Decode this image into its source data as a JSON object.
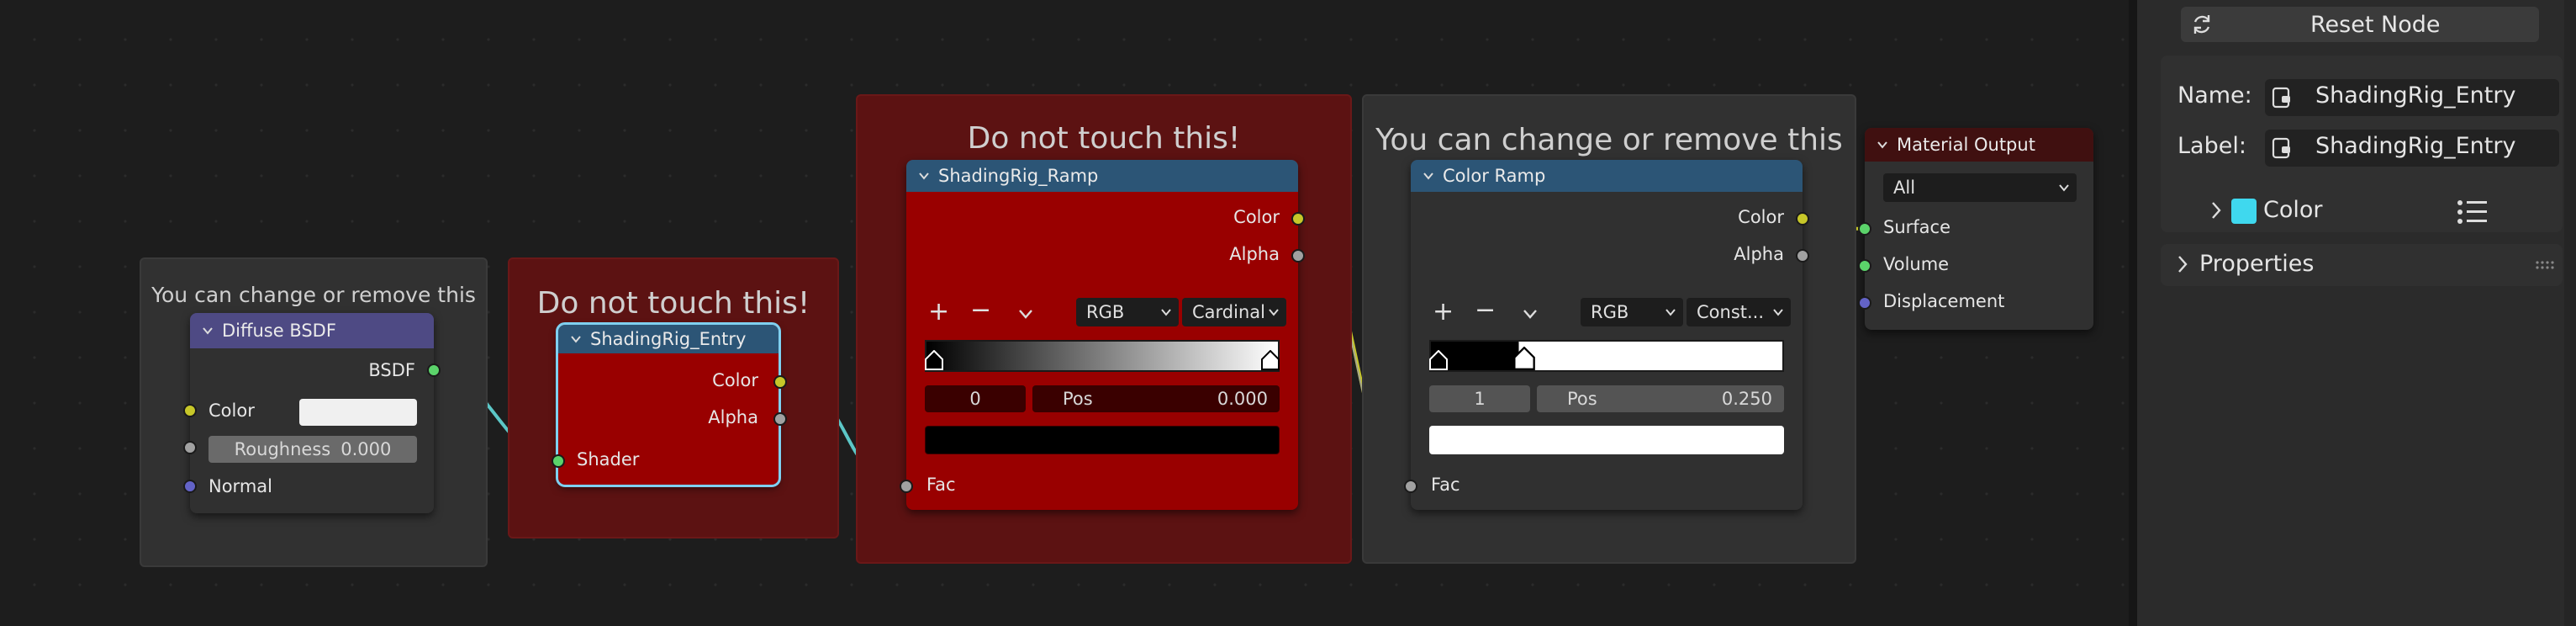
{
  "frames": {
    "diffuse_frame": "You can change or remove this",
    "entry_frame": "Do not touch this!",
    "ramp_frame": "Do not touch this!",
    "colorramp_frame": "You can change or remove this"
  },
  "diffuse_node": {
    "title": "Diffuse BSDF",
    "output": "BSDF",
    "color_label": "Color",
    "color_value": "#f0f0f0",
    "roughness_label": "Roughness",
    "roughness_value": "0.000",
    "normal_label": "Normal"
  },
  "entry_node": {
    "title": "ShadingRig_Entry",
    "out_color": "Color",
    "out_alpha": "Alpha",
    "in_shader": "Shader"
  },
  "rig_ramp_node": {
    "title": "ShadingRig_Ramp",
    "out_color": "Color",
    "out_alpha": "Alpha",
    "mode": "RGB",
    "interpolation": "Cardinal",
    "stop_index": "0",
    "pos_label": "Pos",
    "pos_value": "0.000",
    "stop_color": "#000000",
    "in_fac": "Fac"
  },
  "color_ramp_node": {
    "title": "Color Ramp",
    "out_color": "Color",
    "out_alpha": "Alpha",
    "mode": "RGB",
    "interpolation": "Const...",
    "stop_index": "1",
    "pos_label": "Pos",
    "pos_value": "0.250",
    "stop_color": "#ffffff",
    "in_fac": "Fac"
  },
  "material_output": {
    "title": "Material Output",
    "target": "All",
    "surface": "Surface",
    "volume": "Volume",
    "displacement": "Displacement"
  },
  "sidebar": {
    "reset_label": "Reset Node",
    "name_label": "Name:",
    "name_value": "ShadingRig_Entry",
    "label_label": "Label:",
    "label_value": "ShadingRig_Entry",
    "color_label": "Color",
    "color_swatch": "#3fd8ee",
    "properties_label": "Properties"
  },
  "colors": {
    "accent_select": "#7fd0f0",
    "red_node": "#990000",
    "link_shader": "#5cc7c7",
    "link_color": "#c7c729",
    "link_float": "#a1a1a1"
  }
}
